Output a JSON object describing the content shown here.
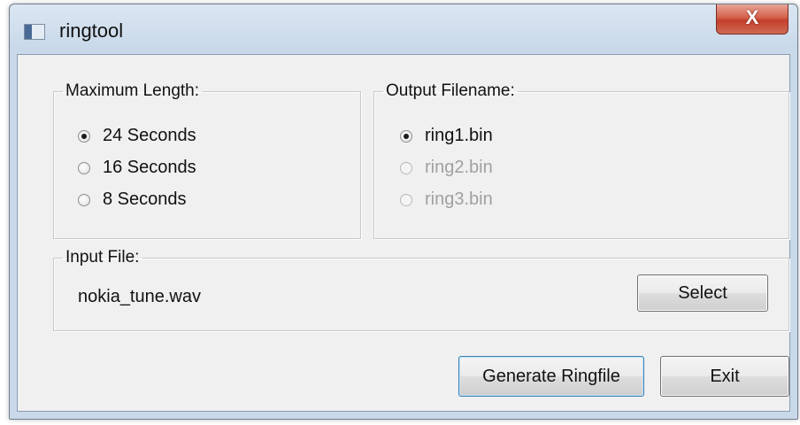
{
  "window": {
    "title": "ringtool",
    "close_glyph": "X"
  },
  "max_length": {
    "legend": "Maximum Length:",
    "options": [
      {
        "label": "24 Seconds",
        "checked": true,
        "enabled": true
      },
      {
        "label": "16 Seconds",
        "checked": false,
        "enabled": true
      },
      {
        "label": "8 Seconds",
        "checked": false,
        "enabled": true
      }
    ]
  },
  "output_filename": {
    "legend": "Output Filename:",
    "options": [
      {
        "label": "ring1.bin",
        "checked": true,
        "enabled": true
      },
      {
        "label": "ring2.bin",
        "checked": false,
        "enabled": false
      },
      {
        "label": "ring3.bin",
        "checked": false,
        "enabled": false
      }
    ]
  },
  "input_file": {
    "legend": "Input File:",
    "value": "nokia_tune.wav",
    "select_label": "Select"
  },
  "actions": {
    "generate_label": "Generate Ringfile",
    "exit_label": "Exit"
  },
  "icons": {
    "app": "app-window-icon",
    "close": "close-icon"
  },
  "colors": {
    "close_button": "#c2402b",
    "disabled_text": "#a0a0a0",
    "dialog_bg": "#f0f0f0"
  }
}
